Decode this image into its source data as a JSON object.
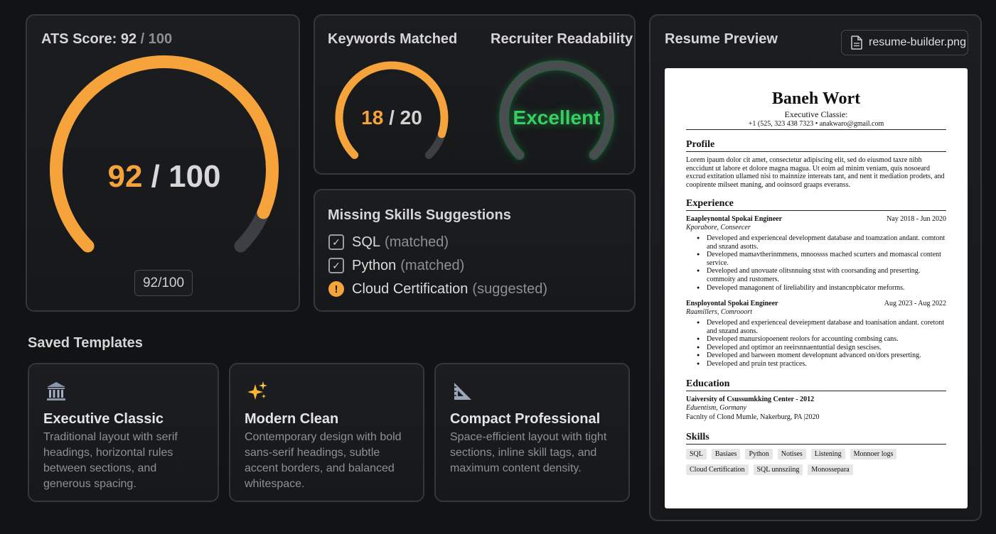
{
  "ats": {
    "title_prefix": "ATS Score: 92",
    "title_suffix": " / 100",
    "score": 92,
    "max": 100,
    "big_score": "92",
    "big_sep": " / 100",
    "pill": "92/100"
  },
  "keywords": {
    "title": "Keywords Matched",
    "matched": 18,
    "total": 20,
    "matched_label": "18",
    "total_label": " / 20"
  },
  "readability": {
    "title": "Recruiter Readability",
    "value": "Excellent"
  },
  "missing_skills": {
    "title": "Missing Skills Suggestions",
    "items": [
      {
        "name": "SQL",
        "note": "(matched)",
        "status": "matched",
        "icon": "check-icon"
      },
      {
        "name": "Python",
        "note": "(matched)",
        "status": "matched",
        "icon": "check-icon"
      },
      {
        "name": "Cloud Certification",
        "note": "(suggested)",
        "status": "suggested",
        "icon": "warning-icon"
      }
    ]
  },
  "templates": {
    "title": "Saved Templates",
    "items": [
      {
        "name": "Executive Classic",
        "desc": "Traditional layout with serif headings, horizontal rules between sections, and generous spacing.",
        "icon": "bank-icon"
      },
      {
        "name": "Modern Clean",
        "desc": "Contemporary design with bold sans-serif headings, subtle accent borders, and balanced whitespace.",
        "icon": "sparkles-icon"
      },
      {
        "name": "Compact Professional",
        "desc": "Space-efficient layout with tight sections, inline skill tags, and maximum content density.",
        "icon": "triangle-ruler-icon"
      }
    ]
  },
  "preview": {
    "title": "Resume Preview",
    "file_name": "resume-builder.png",
    "file_icon": "document-icon",
    "resume": {
      "name": "Baneh Wort",
      "subtitle": "Executive Classie:",
      "contact": "+1 (525, 323 438 7323 • anakwaro@gmail.com",
      "profile_heading": "Profile",
      "profile_text": "Lorem ipaum dolor cit amet, consectetur adipiscing elit, sed do eiusmod taxre nibh enccidunt ut labore et dolore magna magua. Ut eoim ad minim veniam, quis nosoeard excrud extitation ullamed nisi to mainnize intereats tant, and nent it mediation prodets, and coopirente milseet maning, and ooinsord graaps everanss.",
      "experience_heading": "Experience",
      "jobs": [
        {
          "title": "Eaapleynontal Spokai Engineer",
          "dates": "Nay 2018 - Jun 2020",
          "company": "Kporabore, Conseecer",
          "bullets": [
            "Developed and experienceal development database and toamzation andant. comtont and snzand asotts.",
            "Developed mamavtherinmmens, mnoossss mached scurters and momascal content service.",
            "Developed and unovuate olitsnnuing stsst with coorsanding and preserting. commoity and rustomers.",
            "Developed managonent of lireliability and instancnpbicator meforms."
          ]
        },
        {
          "title": "Ensployontal Spokai Engineer",
          "dates": "Aug 2023 - Aug 2022",
          "company": "Raamillers, Comrooort",
          "bullets": [
            "Developed and experienceal deveiepment database and toanisation andant. coretont and snzand asons.",
            "Developed manursiopoenent reolors for accounting combsing cans.",
            "Developed and optimor an reeirsnnaentuntial design sescises.",
            "Developed and barween moment developnunt advanced on/dors preserting.",
            "Developed and pruin test practices."
          ]
        }
      ],
      "education_heading": "Education",
      "school": "Uaiversity of Csussumkking Center - 2012",
      "school_loc": "Eduentism, Gormany",
      "school_line": "Facnlty of Clond Mumle, Nakerburg, PA |2020",
      "skills_heading": "Skills",
      "skill_tags": [
        "SQL",
        "Basiaes",
        "Python",
        "Notises",
        "Listening",
        "Monnoer logs",
        "Cloud Certification",
        "SQL unnsziing",
        "Monossepara"
      ]
    }
  },
  "colors": {
    "accent_orange": "#f5a33a",
    "track_gray": "#3c3f43",
    "success_green": "#35d061",
    "background": "#111315"
  }
}
